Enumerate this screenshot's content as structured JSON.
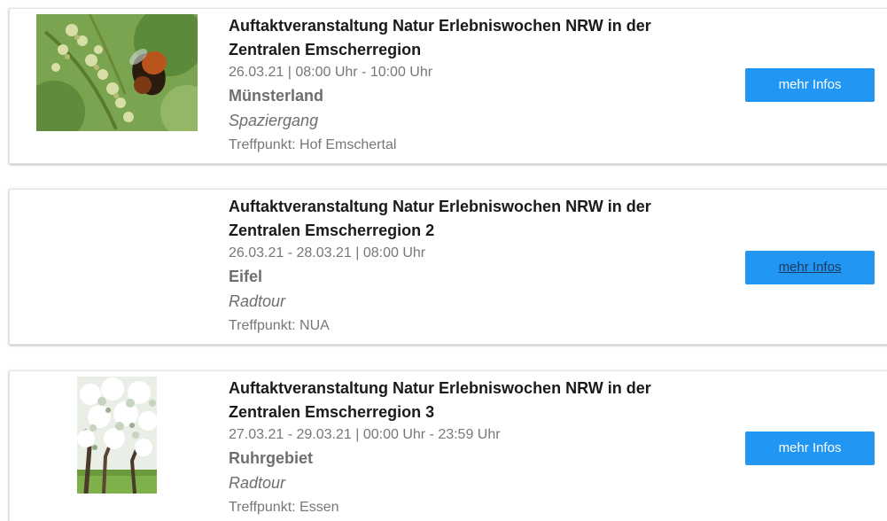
{
  "events": [
    {
      "title": "Auftaktveranstaltung Natur Erlebniswochen NRW in der Zentralen Emscherregion",
      "date": "26.03.21 | 08:00 Uhr - 10:00 Uhr",
      "region": "Münsterland",
      "category": "Spaziergang",
      "meeting_point": "Treffpunkt: Hof Emschertal",
      "button_label": "mehr Infos",
      "image": "bumblebee-on-blossoms-photo"
    },
    {
      "title": "Auftaktveranstaltung Natur Erlebniswochen NRW in der Zentralen Emscherregion 2",
      "date": "26.03.21 - 28.03.21 | 08:00 Uhr",
      "region": "Eifel",
      "category": "Radtour",
      "meeting_point": "Treffpunkt: NUA",
      "button_label": "mehr Infos",
      "image": ""
    },
    {
      "title": "Auftaktveranstaltung Natur Erlebniswochen NRW in der Zentralen Emscherregion 3",
      "date": "27.03.21 - 29.03.21 | 00:00 Uhr - 23:59 Uhr",
      "region": "Ruhrgebiet",
      "category": "Radtour",
      "meeting_point": "Treffpunkt: Essen",
      "button_label": "mehr Infos",
      "image": "blossoming-tree-photo"
    }
  ],
  "colors": {
    "button_bg": "#2196f3",
    "button_text": "#ffffff",
    "title_text": "#1a1a1a",
    "muted_text": "#777777"
  }
}
